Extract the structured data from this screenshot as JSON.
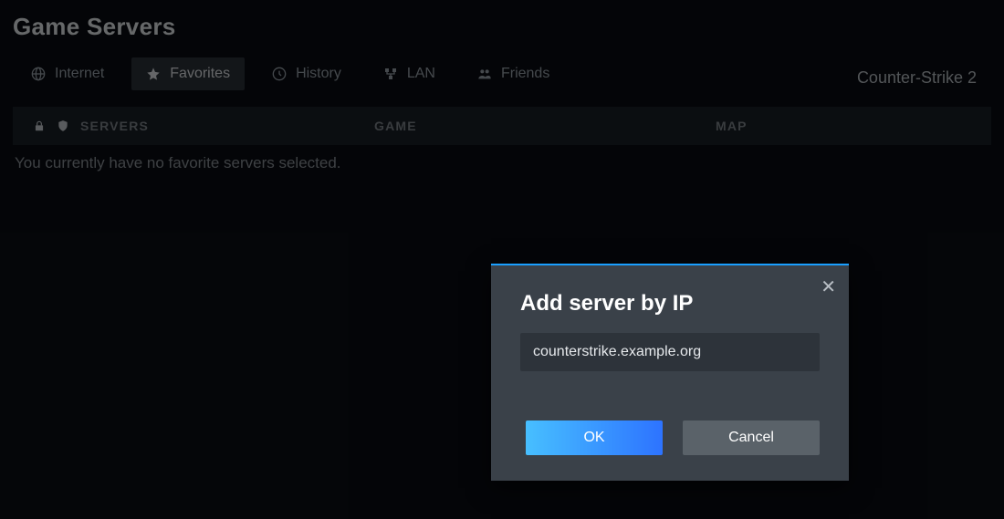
{
  "title": "Game Servers",
  "tabs": {
    "internet": "Internet",
    "favorites": "Favorites",
    "history": "History",
    "lan": "LAN",
    "friends": "Friends"
  },
  "active_tab": "favorites",
  "game_filter_label": "Counter-Strike 2",
  "columns": {
    "servers": "SERVERS",
    "game": "GAME",
    "map": "MAP"
  },
  "empty_message": "You currently have no favorite servers selected.",
  "modal": {
    "title": "Add server by IP",
    "input_value": "counterstrike.example.org",
    "ok": "OK",
    "cancel": "Cancel"
  }
}
